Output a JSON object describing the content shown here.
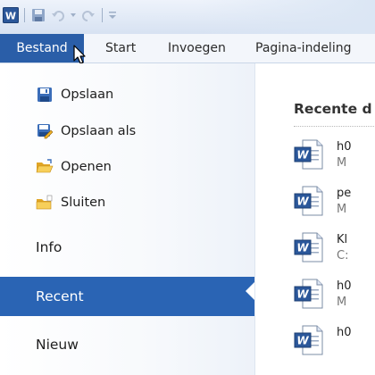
{
  "ribbon": {
    "tabs": [
      {
        "label": "Bestand"
      },
      {
        "label": "Start"
      },
      {
        "label": "Invoegen"
      },
      {
        "label": "Pagina-indeling"
      }
    ]
  },
  "backstage": {
    "commands": [
      {
        "label": "Opslaan",
        "icon": "save-icon"
      },
      {
        "label": "Opslaan als",
        "icon": "save-as-icon"
      },
      {
        "label": "Openen",
        "icon": "open-folder-icon"
      },
      {
        "label": "Sluiten",
        "icon": "close-folder-icon"
      }
    ],
    "pages": [
      {
        "label": "Info"
      },
      {
        "label": "Recent",
        "selected": true
      },
      {
        "label": "Nieuw"
      }
    ]
  },
  "recent": {
    "title": "Recente d",
    "documents": [
      {
        "name": "h0",
        "path": "M"
      },
      {
        "name": "pe",
        "path": "M"
      },
      {
        "name": "Kl",
        "path": "C:"
      },
      {
        "name": "h0",
        "path": "M"
      },
      {
        "name": "h0",
        "path": ""
      }
    ]
  },
  "colors": {
    "file_tab": "#2a5ea8",
    "selected_nav": "#2a64b4"
  }
}
